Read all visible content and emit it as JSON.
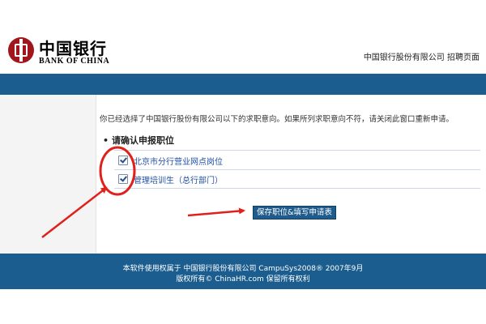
{
  "header": {
    "logo_cn": "中国银行",
    "logo_en": "BANK OF CHINA",
    "top_right": "中国银行股份有限公司 招聘页面"
  },
  "main": {
    "instruction": "你已经选择了中国银行股份有限公司以下的求职意向。如果所列求职意向不符，请关闭此窗口重新申请。",
    "section_title": "请确认申报职位",
    "items": [
      {
        "label": "北京市分行营业网点岗位"
      },
      {
        "label": "管理培训生（总行部门）"
      }
    ],
    "save_button": "保存职位&填写申请表"
  },
  "footer": {
    "line1": "本软件使用权属于 中国银行股份有限公司 CampuSys2008® 2007年9月",
    "line2": "版权所有© ChinaHR.com 保留所有权利"
  },
  "colors": {
    "brand_red": "#a0161c",
    "band_blue": "#1b5d8e",
    "link_blue": "#1f4fa3",
    "annotation_red": "#e0201b"
  }
}
